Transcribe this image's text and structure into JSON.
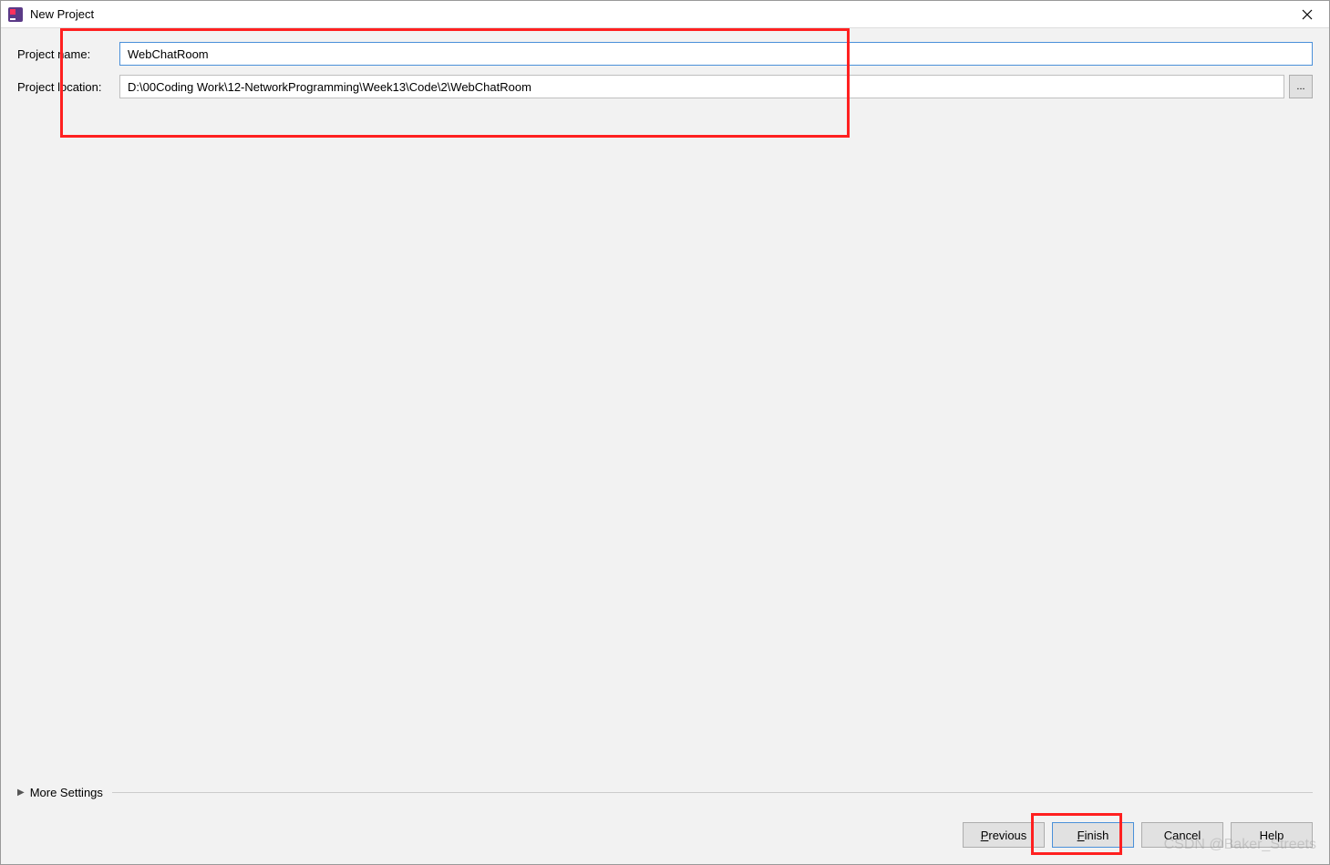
{
  "titleBar": {
    "title": "New Project"
  },
  "form": {
    "projectNameLabel": "Project name:",
    "projectNameValue": "WebChatRoom",
    "projectLocationLabel": "Project location:",
    "projectLocationValue": "D:\\00Coding Work\\12-NetworkProgramming\\Week13\\Code\\2\\WebChatRoom",
    "browseLabel": "..."
  },
  "moreSettings": {
    "label": "More Settings"
  },
  "buttons": {
    "previous": "Previous",
    "finish": "Finish",
    "cancel": "Cancel",
    "help": "Help"
  },
  "watermark": "CSDN @Baker_Streets"
}
